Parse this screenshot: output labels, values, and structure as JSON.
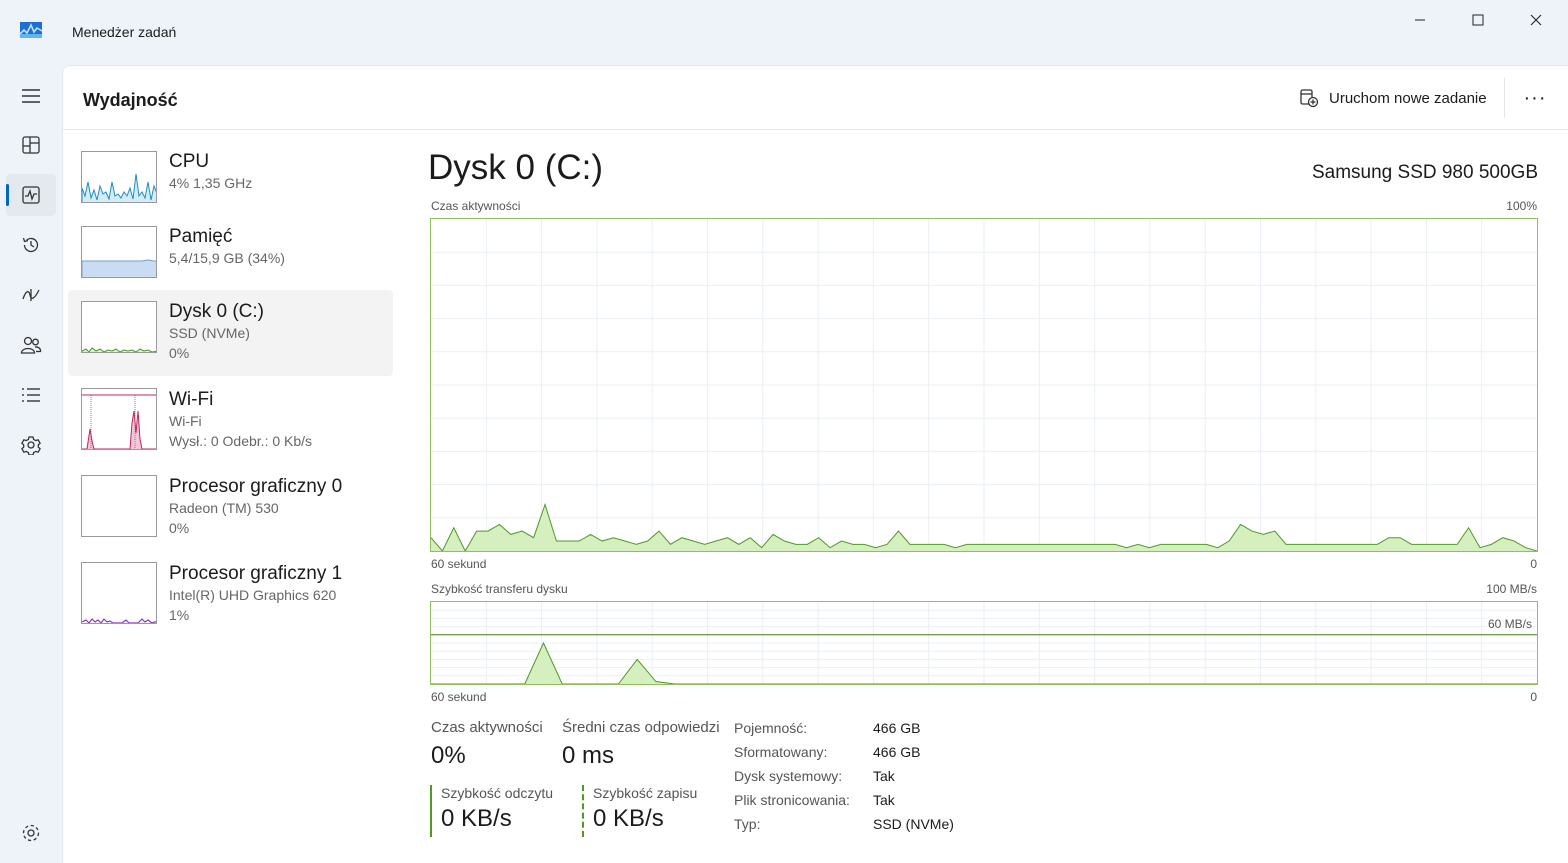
{
  "window": {
    "title": "Menedżer zadań"
  },
  "header": {
    "title": "Wydajność",
    "run_task_label": "Uruchom nowe zadanie",
    "more_label": "···"
  },
  "nav": {
    "items": [
      {
        "icon": "hamburger-icon"
      },
      {
        "icon": "processes-icon"
      },
      {
        "icon": "performance-icon",
        "active": true
      },
      {
        "icon": "app-history-icon"
      },
      {
        "icon": "startup-apps-icon"
      },
      {
        "icon": "users-icon"
      },
      {
        "icon": "details-icon"
      },
      {
        "icon": "services-icon"
      },
      {
        "icon": "settings-icon"
      }
    ]
  },
  "devices": [
    {
      "name": "CPU",
      "line1": "4%  1,35 GHz",
      "line2": "",
      "color": "#1e8ec2"
    },
    {
      "name": "Pamięć",
      "line1": "5,4/15,9 GB (34%)",
      "line2": "",
      "color": "#6c9fd6"
    },
    {
      "name": "Dysk 0 (C:)",
      "line1": "SSD (NVMe)",
      "line2": "0%",
      "color": "#4d9a26",
      "selected": true
    },
    {
      "name": "Wi-Fi",
      "line1": "Wi-Fi",
      "line2": "Wysł.: 0  Odebr.: 0 Kb/s",
      "color": "#c0245e"
    },
    {
      "name": "Procesor graficzny 0",
      "line1": "Radeon (TM) 530",
      "line2": "0%",
      "color": "#8a36c4"
    },
    {
      "name": "Procesor graficzny 1",
      "line1": "Intel(R) UHD Graphics 620",
      "line2": "1%",
      "color": "#8a36c4"
    }
  ],
  "detail": {
    "title": "Dysk 0 (C:)",
    "model": "Samsung SSD 980 500GB",
    "activity_chart": {
      "label": "Czas aktywności",
      "max_label": "100%",
      "x_left": "60 sekund",
      "x_right": "0"
    },
    "transfer_chart": {
      "label": "Szybkość transferu dysku",
      "max_label": "100 MB/s",
      "line_label": "60 MB/s",
      "x_left": "60 sekund",
      "x_right": "0"
    },
    "stats": {
      "active_time_label": "Czas aktywności",
      "active_time_value": "0%",
      "avg_response_label": "Średni czas odpowiedzi",
      "avg_response_value": "0 ms",
      "read_speed_label": "Szybkość odczytu",
      "read_speed_value": "0 KB/s",
      "write_speed_label": "Szybkość zapisu",
      "write_speed_value": "0 KB/s"
    },
    "properties": [
      {
        "key": "Pojemność:",
        "value": "466 GB"
      },
      {
        "key": "Sformatowany:",
        "value": "466 GB"
      },
      {
        "key": "Dysk systemowy:",
        "value": "Tak"
      },
      {
        "key": "Plik stronicowania:",
        "value": "Tak"
      },
      {
        "key": "Typ:",
        "value": "SSD (NVMe)"
      }
    ]
  },
  "chart_data": [
    {
      "type": "area",
      "title": "Czas aktywności",
      "ylabel": "",
      "xlabel": "",
      "x_range_label": [
        "60 sekund",
        "0"
      ],
      "ylim": [
        0,
        100
      ],
      "grid": true,
      "series": [
        {
          "values": [
            4,
            0,
            7,
            0,
            6,
            6,
            8,
            5,
            6,
            4,
            14,
            3,
            3,
            3,
            5,
            3,
            4,
            3,
            2,
            3,
            6,
            2,
            4,
            3,
            2,
            3,
            4,
            2,
            4,
            1,
            5,
            3,
            2,
            2,
            4,
            1,
            3,
            2,
            2,
            1,
            2,
            6,
            2,
            2,
            2,
            2,
            1,
            2,
            2,
            2,
            2,
            2,
            2,
            2,
            2,
            2,
            2,
            2,
            2,
            2,
            2,
            1,
            2,
            1,
            2,
            2,
            2,
            2,
            2,
            1,
            3,
            8,
            6,
            5,
            6,
            2,
            2,
            2,
            2,
            2,
            2,
            2,
            2,
            2,
            4,
            4,
            2,
            2,
            2,
            2,
            2,
            7,
            1,
            2,
            4,
            3,
            1,
            0
          ]
        }
      ]
    },
    {
      "type": "area",
      "title": "Szybkość transferu dysku",
      "ylabel": "",
      "xlabel": "",
      "x_range_label": [
        "60 sekund",
        "0"
      ],
      "ylim": [
        0,
        100
      ],
      "reference_line": 60,
      "grid": true,
      "series": [
        {
          "values": [
            0,
            0,
            0,
            0,
            0,
            0,
            50,
            0,
            0,
            0,
            0,
            30,
            3,
            0,
            0,
            0,
            0,
            0,
            0,
            0,
            0,
            0,
            0,
            0,
            0,
            0,
            0,
            0,
            0,
            0,
            0,
            0,
            0,
            0,
            0,
            0,
            0,
            0,
            0,
            0,
            0,
            0,
            0,
            0,
            0,
            0,
            0,
            0,
            0,
            0,
            0,
            0,
            0,
            0,
            0,
            0,
            0,
            0,
            0,
            0
          ]
        }
      ]
    }
  ]
}
